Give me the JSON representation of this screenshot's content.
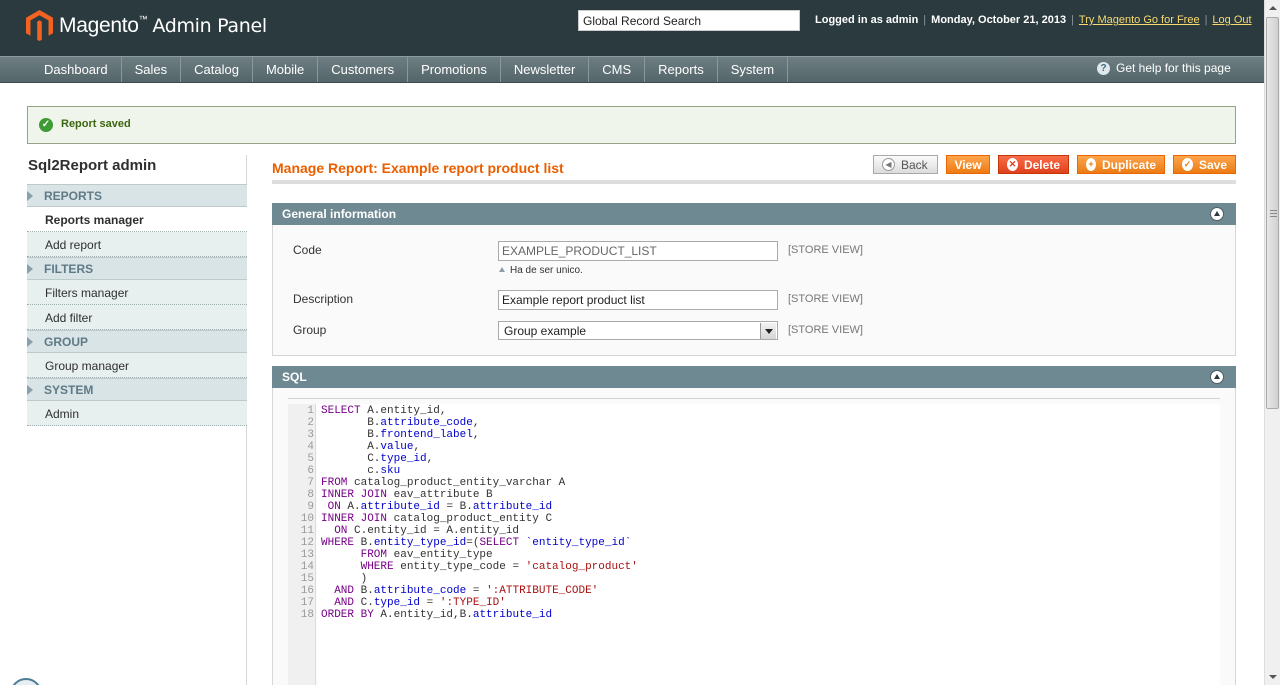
{
  "header": {
    "brand": "Magento",
    "brand_sub": "Admin Panel",
    "search_value": "Global Record Search",
    "logged_in": "Logged in as admin",
    "date": "Monday, October 21, 2013",
    "try_link": "Try Magento Go for Free",
    "logout": "Log Out"
  },
  "nav": {
    "items": [
      "Dashboard",
      "Sales",
      "Catalog",
      "Mobile",
      "Customers",
      "Promotions",
      "Newsletter",
      "CMS",
      "Reports",
      "System"
    ],
    "help": "Get help for this page"
  },
  "message": "Report saved",
  "sidebar": {
    "title": "Sql2Report admin",
    "sections": [
      {
        "label": "REPORTS",
        "items": [
          "Reports manager",
          "Add report"
        ]
      },
      {
        "label": "FILTERS",
        "items": [
          "Filters manager",
          "Add filter"
        ]
      },
      {
        "label": "GROUP",
        "items": [
          "Group manager"
        ]
      },
      {
        "label": "SYSTEM",
        "items": [
          "Admin"
        ]
      }
    ]
  },
  "page": {
    "title": "Manage Report: Example report product list",
    "buttons": {
      "back": "Back",
      "view": "View",
      "delete": "Delete",
      "duplicate": "Duplicate",
      "save": "Save"
    }
  },
  "general": {
    "header": "General information",
    "code_label": "Code",
    "code_value": "EXAMPLE_PRODUCT_LIST",
    "code_note": "Ha de ser unico.",
    "description_label": "Description",
    "description_value": "Example report product list",
    "group_label": "Group",
    "group_value": "Group example",
    "scope": "[STORE VIEW]"
  },
  "sql": {
    "header": "SQL",
    "lines": [
      "SELECT A.entity_id,",
      "       B.attribute_code,",
      "       B.frontend_label,",
      "       A.value,",
      "       C.type_id,",
      "       c.sku",
      "FROM catalog_product_entity_varchar A",
      "INNER JOIN eav_attribute B",
      " ON A.attribute_id = B.attribute_id",
      "INNER JOIN catalog_product_entity C",
      "  ON C.entity_id = A.entity_id",
      "WHERE B.entity_type_id=(SELECT `entity_type_id`",
      "      FROM eav_entity_type",
      "      WHERE entity_type_code = 'catalog_product'",
      "      )",
      "  AND B.attribute_code = ':ATTRIBUTE_CODE'",
      "  AND C.type_id = ':TYPE_ID'",
      "ORDER BY A.entity_id,B.attribute_id"
    ]
  },
  "colors": {
    "header_bg": "#2b3a3f",
    "accent_orange": "#eb5e00",
    "panel_head": "#6f8992"
  }
}
